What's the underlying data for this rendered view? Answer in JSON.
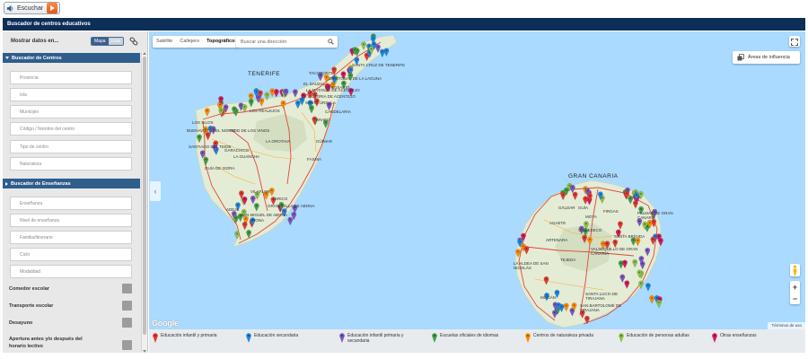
{
  "listen": {
    "label": "Escuchar"
  },
  "header": {
    "title": "Buscador de centros educativos"
  },
  "sidebar": {
    "show_label": "Mostrar datos en...",
    "toggle": {
      "map": "Mapa",
      "list": "Lista"
    },
    "centros_section": "Buscador de Centros",
    "centros_fields": [
      "Provincia",
      "Isla",
      "Municipio",
      "Código / Nombre del centro",
      "Tipo de centro",
      "Naturaleza"
    ],
    "ensenanzas_section": "Buscador de Enseñanzas",
    "ensenanzas_fields": [
      "Enseñanza",
      "Nivel de enseñanza",
      "Familia/itinerario",
      "Ciclo",
      "Modalidad"
    ],
    "checks": [
      "Comedor escolar",
      "Transporte escolar",
      "Desayuno",
      "Apertura antes y/o después del horario lectivo"
    ]
  },
  "map": {
    "types": [
      "Satélite",
      "Callejero",
      "Topográfico"
    ],
    "selected_type": "Topográfico",
    "search_placeholder": "Buscar una dirección",
    "influence_label": "Áreas de influencia",
    "google": "Google",
    "terms": "Términos de uso",
    "islands": {
      "tenerife": "TENERIFE",
      "gran_canaria": "GRAN CANARIA"
    },
    "towns": {
      "t1": "SANTA CRUZ DE TENERIFE",
      "t2": "TACORONTE",
      "t3": "CRISTÓBAL DE LA LAGUNA",
      "t4": "EL ROSARIO",
      "t5": "EL SAUZAL",
      "t6": "LA MATANZA DE ACENTEJO",
      "t7": "LA VICTORIA DE ACENTEJO",
      "t8": "SANTA ÚRSULA",
      "t9": "LOS REALEJOS",
      "t10": "CANDELARIA",
      "t11": "ARAFO",
      "t12": "LOS SILOS",
      "t13": "BUENAVISTA DEL NORTE",
      "t14": "ICOD DE LOS VINOS",
      "t15": "GARACHICO",
      "t16": "LA GUANCHA",
      "t17": "LA OROTAVA",
      "t18": "GÜÍMAR",
      "t19": "SANTIAGO DEL TEIDE",
      "t20": "GUÍA DE ISORA",
      "t21": "FASNIA",
      "t22": "VILAFLOR",
      "t23": "ARICO",
      "t24": "GRANADILLA DE ABONA",
      "t25": "SAN MIGUEL DE ABONA",
      "t26": "ADEJE",
      "t27": "ARONA",
      "g1": "GÁLDAR",
      "g2": "GUÍA",
      "g3": "MOYA",
      "g4": "FIRGAS",
      "g5": "AGAETE",
      "g6": "VALLESECO",
      "g7": "ARTENARA",
      "g8": "TEJEDA",
      "g9": "LA ALDEA DE SAN NICOLÁS",
      "g10": "MOGÁN",
      "g11": "SANTA LUCÍA DE TIRAJANA",
      "g12": "SAN BARTOLOMÉ DE TIRAJANA",
      "g13": "VALSEQUILLO DE GRAN CANARIA",
      "g14": "PALMAS DE GRAN CANARIA",
      "g15": "SANTA BRÍGIDA"
    }
  },
  "legend": [
    {
      "label": "Educación infantil y primaria",
      "color": "#e53935"
    },
    {
      "label": "Educación secundaria",
      "color": "#1e88e5"
    },
    {
      "label": "Educación infantil primaria y secundaria",
      "color": "#7e57c2"
    },
    {
      "label": "Escuelas oficiales de idiomas",
      "color": "#43a047"
    },
    {
      "label": "Centros de naturaleza privada",
      "color": "#fb8c00"
    },
    {
      "label": "Educación de personas adultas",
      "color": "#8bc34a"
    },
    {
      "label": "Otras enseñanzas",
      "color": "#d81b60"
    }
  ]
}
